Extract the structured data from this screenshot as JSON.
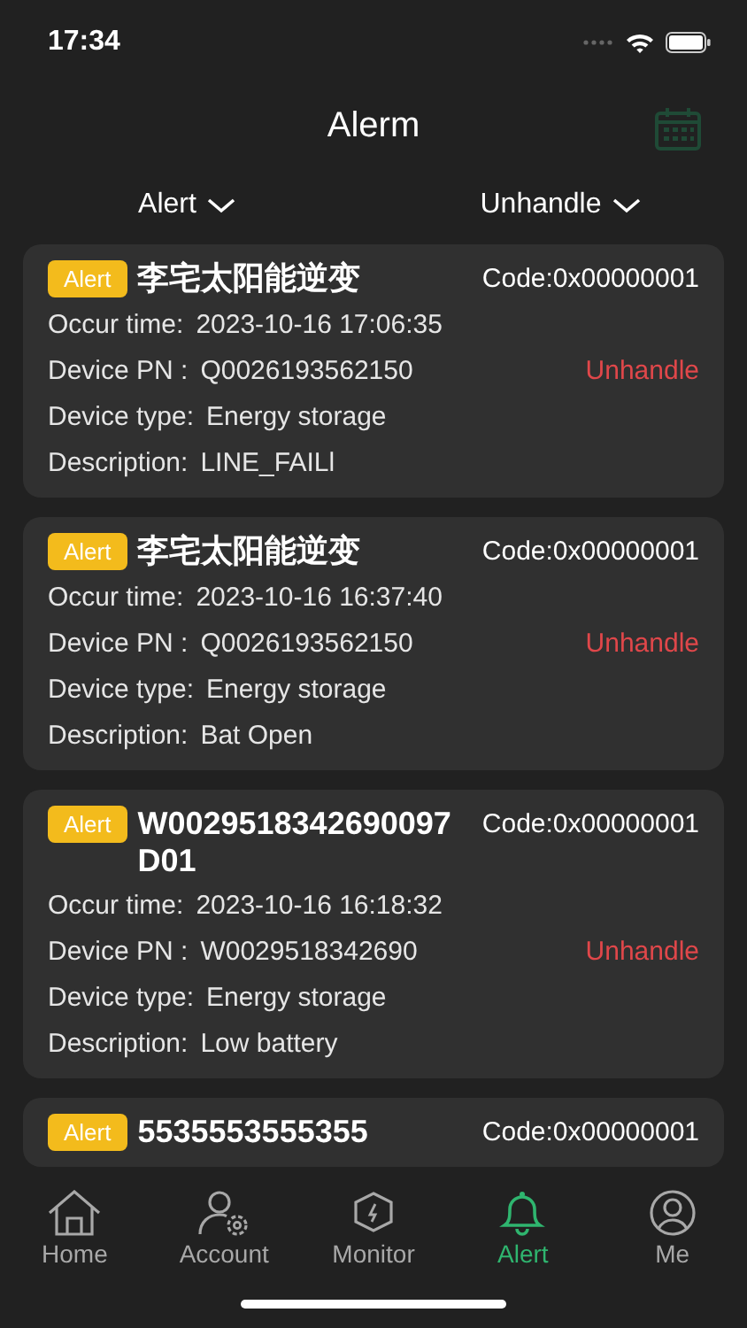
{
  "status_bar": {
    "time": "17:34"
  },
  "header": {
    "title": "Alerm"
  },
  "filters": [
    {
      "label": "Alert"
    },
    {
      "label": "Unhandle"
    }
  ],
  "alerts": [
    {
      "level": "Alert",
      "title": "李宅太阳能逆变",
      "code": "Code:0x00000001",
      "occur_label": "Occur time:",
      "occur_time": "2023-10-16 17:06:35",
      "pn_label": "Device PN :",
      "pn": "Q0026193562150",
      "status": "Unhandle",
      "type_label": "Device type:",
      "type": "Energy storage",
      "desc_label": "Description:",
      "description": "LINE_FAILl"
    },
    {
      "level": "Alert",
      "title": "李宅太阳能逆变",
      "code": "Code:0x00000001",
      "occur_label": "Occur time:",
      "occur_time": "2023-10-16 16:37:40",
      "pn_label": "Device PN :",
      "pn": "Q0026193562150",
      "status": "Unhandle",
      "type_label": "Device type:",
      "type": "Energy storage",
      "desc_label": "Description:",
      "description": "Bat Open"
    },
    {
      "level": "Alert",
      "title": "W0029518342690097D01",
      "code": "Code:0x00000001",
      "occur_label": "Occur time:",
      "occur_time": "2023-10-16 16:18:32",
      "pn_label": "Device PN :",
      "pn": "W0029518342690",
      "status": "Unhandle",
      "type_label": "Device type:",
      "type": "Energy storage",
      "desc_label": "Description:",
      "description": "Low battery"
    },
    {
      "level": "Alert",
      "title": "5535553555355",
      "code": "Code:0x00000001"
    }
  ],
  "tabs": [
    {
      "label": "Home",
      "kind": "home",
      "selected": false
    },
    {
      "label": "Account",
      "kind": "account",
      "selected": false
    },
    {
      "label": "Monitor",
      "kind": "monitor",
      "selected": false
    },
    {
      "label": "Alert",
      "kind": "alert",
      "selected": true
    },
    {
      "label": "Me",
      "kind": "me",
      "selected": false
    }
  ]
}
